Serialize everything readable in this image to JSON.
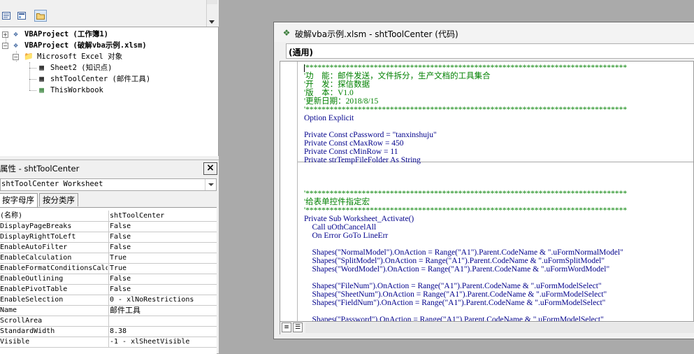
{
  "project_explorer": {
    "toolbar_icons": [
      "view-code-icon",
      "view-object-icon",
      "toggle-folders-icon"
    ],
    "tree": {
      "project1_label": "VBAProject (工作簿1)",
      "project2_label": "VBAProject (破解vba示例.xlsm)",
      "folder_label": "Microsoft Excel 对象",
      "items": [
        {
          "label": "Sheet2 (知识点)"
        },
        {
          "label": "shtToolCenter (邮件工具)"
        },
        {
          "label": "ThisWorkbook"
        }
      ]
    }
  },
  "properties_window": {
    "title": "属性 - shtToolCenter",
    "object_combo": "shtToolCenter Worksheet",
    "tabs": [
      "按字母序",
      "按分类序"
    ],
    "rows": [
      {
        "name": "(名称)",
        "value": "shtToolCenter"
      },
      {
        "name": "DisplayPageBreaks",
        "value": "False"
      },
      {
        "name": "DisplayRightToLeft",
        "value": "False"
      },
      {
        "name": "EnableAutoFilter",
        "value": "False"
      },
      {
        "name": "EnableCalculation",
        "value": "True"
      },
      {
        "name": "EnableFormatConditionsCalc",
        "value": "True"
      },
      {
        "name": "EnableOutlining",
        "value": "False"
      },
      {
        "name": "EnablePivotTable",
        "value": "False"
      },
      {
        "name": "EnableSelection",
        "value": "0 - xlNoRestrictions"
      },
      {
        "name": "Name",
        "value": "邮件工具"
      },
      {
        "name": "ScrollArea",
        "value": ""
      },
      {
        "name": "StandardWidth",
        "value": "8.38"
      },
      {
        "name": "Visible",
        "value": "-1 - xlSheetVisible"
      }
    ]
  },
  "code_window": {
    "title": "破解vba示例.xlsm - shtToolCenter (代码)",
    "object_combo": "(通用)",
    "lines": [
      {
        "text": "'********************************************************************************",
        "style": "cmt"
      },
      {
        "text": "'功    能：邮件发送，文件拆分，生产文档的工具集合",
        "style": "cmt"
      },
      {
        "text": "'开    发：探信数据",
        "style": "cmt"
      },
      {
        "text": "'版    本：V1.0",
        "style": "cmt"
      },
      {
        "text": "'更新日期：2018/8/15",
        "style": "cmt"
      },
      {
        "text": "'********************************************************************************",
        "style": "cmt"
      },
      {
        "text": "Option Explicit",
        "style": "kw"
      },
      {
        "text": "",
        "style": "kw"
      },
      {
        "text": "Private Const cPassword = \"tanxinshuju\"",
        "style": "kw"
      },
      {
        "text": "Private Const cMaxRow = 450",
        "style": "kw"
      },
      {
        "text": "Private Const cMinRow = 11",
        "style": "kw"
      },
      {
        "text": "Private strTempFileFolder As String",
        "style": "kw"
      },
      {
        "text": "",
        "style": "kw"
      },
      {
        "text": "",
        "style": "kw"
      },
      {
        "text": "",
        "style": "kw"
      },
      {
        "text": "'********************************************************************************",
        "style": "cmt"
      },
      {
        "text": "'给表单控件指定宏",
        "style": "cmt"
      },
      {
        "text": "'********************************************************************************",
        "style": "cmt"
      },
      {
        "text": "Private Sub Worksheet_Activate()",
        "style": "kw"
      },
      {
        "text": "    Call uOthCancelAll",
        "style": "kw"
      },
      {
        "text": "    On Error GoTo LineErr",
        "style": "kw"
      },
      {
        "text": "",
        "style": "kw"
      },
      {
        "text": "    Shapes(\"NormalModel\").OnAction = Range(\"A1\").Parent.CodeName & \".uFormNormalModel\"",
        "style": "kw"
      },
      {
        "text": "    Shapes(\"SplitModel\").OnAction = Range(\"A1\").Parent.CodeName & \".uFormSplitModel\"",
        "style": "kw"
      },
      {
        "text": "    Shapes(\"WordModel\").OnAction = Range(\"A1\").Parent.CodeName & \".uFormWordModel\"",
        "style": "kw"
      },
      {
        "text": "",
        "style": "kw"
      },
      {
        "text": "    Shapes(\"FileNum\").OnAction = Range(\"A1\").Parent.CodeName & \".uFormModelSelect\"",
        "style": "kw"
      },
      {
        "text": "    Shapes(\"SheetNum\").OnAction = Range(\"A1\").Parent.CodeName & \".uFormModelSelect\"",
        "style": "kw"
      },
      {
        "text": "    Shapes(\"FieldNum\").OnAction = Range(\"A1\").Parent.CodeName & \".uFormModelSelect\"",
        "style": "kw"
      },
      {
        "text": "",
        "style": "kw"
      },
      {
        "text": "    Shapes(\"Password\").OnAction = Range(\"A1\").Parent.CodeName & \".uFormModelSelect\"",
        "style": "kw"
      }
    ]
  }
}
